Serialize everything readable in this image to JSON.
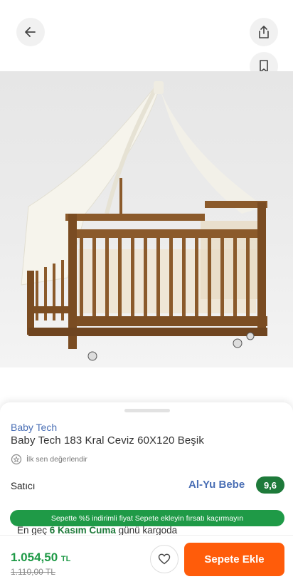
{
  "header": {
    "back_icon": "arrow-left-icon",
    "share_icon": "share-icon",
    "bookmark_icon": "bookmark-icon"
  },
  "product": {
    "image": "crib-photo",
    "brand": "Baby Tech",
    "title": "Baby Tech 183 Kral Ceviz 60X120 Beşik",
    "rating_prompt": "İlk sen değerlendir"
  },
  "seller": {
    "label": "Satıcı",
    "name": "Al-Yu Bebe",
    "score": "9,6"
  },
  "promo": {
    "text": "Sepette %5 indirimli fiyat Sepete ekleyin fırsatı kaçırmayın"
  },
  "delivery": {
    "prefix": "En geç",
    "date": "6 Kasım Cuma",
    "suffix": "günü kargoda"
  },
  "purchase": {
    "price": "1.054,50",
    "currency": "TL",
    "old_price": "1.110,00 TL",
    "cart_label": "Sepete Ekle"
  },
  "colors": {
    "accent_green": "#1f9a47",
    "seller_blue": "#4a6fb5",
    "cart_orange": "#ff5c0a",
    "score_green": "#1e7a3a"
  }
}
